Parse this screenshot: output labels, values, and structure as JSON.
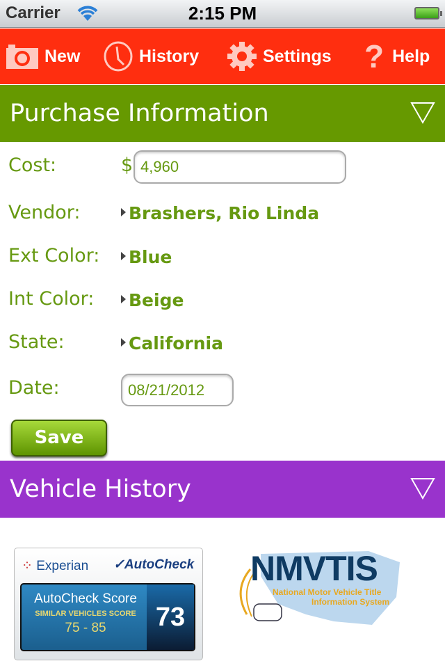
{
  "status_bar": {
    "carrier": "Carrier",
    "time": "2:15 PM"
  },
  "nav": {
    "items": [
      {
        "label": "New",
        "icon": "camera-icon"
      },
      {
        "label": "History",
        "icon": "clock-icon"
      },
      {
        "label": "Settings",
        "icon": "gear-icon"
      },
      {
        "label": "Help",
        "icon": "question-icon"
      }
    ]
  },
  "purchase": {
    "title": "Purchase Information",
    "cost_label": "Cost:",
    "currency": "$",
    "cost_value": "4,960",
    "vendor_label": "Vendor:",
    "vendor": "Brashers, Rio Linda",
    "ext_label": "Ext Color:",
    "ext": "Blue",
    "int_label": "Int Color:",
    "int": "Beige",
    "state_label": "State:",
    "state": "California",
    "date_label": "Date:",
    "date": "08/21/2012",
    "save": "Save"
  },
  "history": {
    "title": "Vehicle History",
    "autocheck": {
      "experian": "Experian",
      "brand": "AutoCheck",
      "score_label": "AutoCheck Score",
      "similar_label": "SIMILAR VEHICLES SCORE",
      "similar_range": "75 - 85",
      "score": "73"
    },
    "nmvtis": {
      "name": "NMVTIS",
      "line1": "National Motor Vehicle Title",
      "line2": "Information System"
    }
  },
  "colors": {
    "nav": "#ff2e0f",
    "purchase_header": "#669900",
    "history_header": "#9933cc",
    "text": "#669911"
  }
}
